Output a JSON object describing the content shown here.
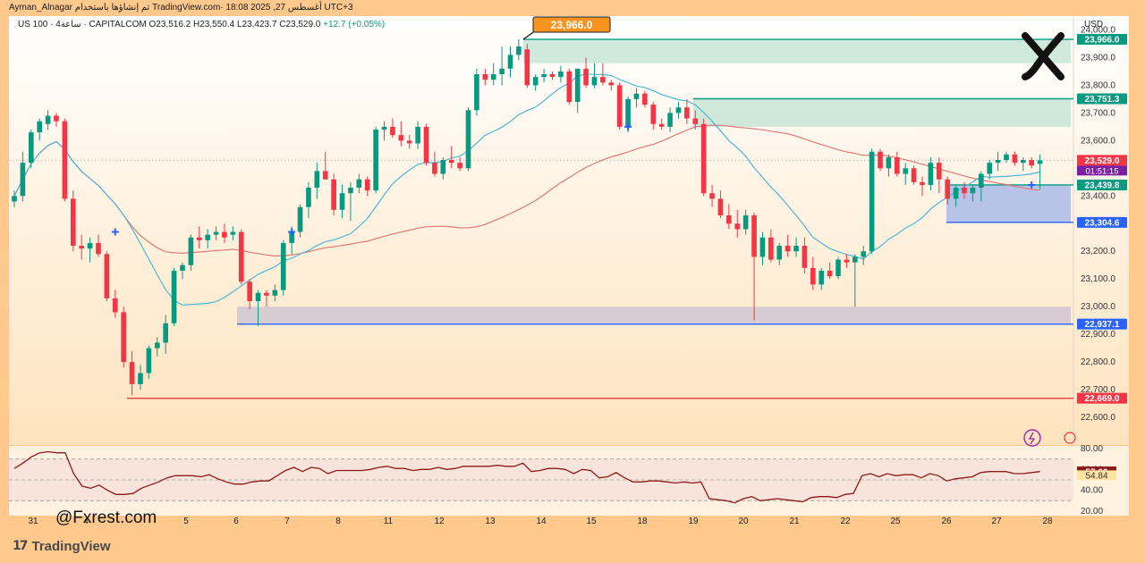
{
  "header": {
    "author": "Ayman_Alnagar",
    "published_text": "تم إنشاؤها باستخدام TradingView.com· 18:08 2025 ,27 أغسطس UTC+3"
  },
  "symbol": {
    "name": "US 100 · 4ساعة · CAPITALCOM",
    "open": "O23,516.2",
    "high": "H23,550.4",
    "low": "L23,423.7",
    "close": "C23,529.0",
    "change": "+12.7 (+0.05%)"
  },
  "currency": "USD",
  "watermark": "@Fxrest.com",
  "brand": {
    "logo": "17",
    "name": "TradingView"
  },
  "colors": {
    "up": "#089981",
    "down": "#F23645",
    "ma_fast": "#4DB8D4",
    "ma_slow": "#E07A78",
    "rsi": "#8B1A1A",
    "supply_zone": "#BFE3D2",
    "demand_zone": "#9FB3E8",
    "support_zone": "#C9C2D2",
    "page_bg": "#FFC98E"
  },
  "chart_data": {
    "type": "candlestick",
    "y_axis": {
      "min": 22500,
      "max": 24050,
      "ticks": [
        22600,
        22700,
        22800,
        22900,
        23000,
        23100,
        23200,
        23300,
        23400,
        23500,
        23600,
        23700,
        23800,
        23900,
        24000
      ],
      "tick_labels": [
        "22,600.0",
        "22,700.0",
        "22,800.0",
        "22,900.0",
        "23,000.0",
        "23,100.0",
        "23,200.0",
        "23,300.0",
        "23,400.0",
        "23,500.0",
        "23,600.0",
        "23,700.0",
        "23,800.0",
        "23,900.0",
        "24,000.0"
      ]
    },
    "x_labels": [
      "31",
      "4",
      "5",
      "6",
      "7",
      "8",
      "11",
      "12",
      "13",
      "14",
      "15",
      "18",
      "19",
      "20",
      "21",
      "22",
      "25",
      "26",
      "27",
      "28"
    ],
    "candles": [
      [
        23380,
        23420,
        23360,
        23400
      ],
      [
        23400,
        23560,
        23380,
        23520
      ],
      [
        23520,
        23640,
        23500,
        23630
      ],
      [
        23630,
        23680,
        23600,
        23670
      ],
      [
        23660,
        23710,
        23640,
        23690
      ],
      [
        23690,
        23700,
        23650,
        23670
      ],
      [
        23670,
        23680,
        23380,
        23390
      ],
      [
        23390,
        23420,
        23200,
        23220
      ],
      [
        23220,
        23260,
        23170,
        23210
      ],
      [
        23210,
        23250,
        23160,
        23230
      ],
      [
        23230,
        23260,
        23180,
        23190
      ],
      [
        23190,
        23200,
        23020,
        23030
      ],
      [
        23030,
        23060,
        22960,
        22980
      ],
      [
        22980,
        23000,
        22780,
        22800
      ],
      [
        22800,
        22840,
        22680,
        22720
      ],
      [
        22720,
        22790,
        22700,
        22760
      ],
      [
        22760,
        22860,
        22740,
        22850
      ],
      [
        22850,
        22890,
        22820,
        22870
      ],
      [
        22870,
        22970,
        22830,
        22940
      ],
      [
        22940,
        23140,
        22930,
        23130
      ],
      [
        23130,
        23160,
        23100,
        23150
      ],
      [
        23150,
        23260,
        23130,
        23250
      ],
      [
        23250,
        23290,
        23210,
        23240
      ],
      [
        23240,
        23280,
        23210,
        23260
      ],
      [
        23260,
        23290,
        23240,
        23270
      ],
      [
        23270,
        23300,
        23230,
        23250
      ],
      [
        23260,
        23290,
        23240,
        23270
      ],
      [
        23270,
        23280,
        23080,
        23090
      ],
      [
        23090,
        23100,
        22990,
        23020
      ],
      [
        23020,
        23060,
        22930,
        23050
      ],
      [
        23050,
        23060,
        23000,
        23040
      ],
      [
        23040,
        23080,
        23020,
        23060
      ],
      [
        23060,
        23240,
        23040,
        23230
      ],
      [
        23230,
        23290,
        23190,
        23270
      ],
      [
        23270,
        23370,
        23250,
        23360
      ],
      [
        23360,
        23450,
        23320,
        23430
      ],
      [
        23430,
        23520,
        23390,
        23490
      ],
      [
        23490,
        23560,
        23460,
        23460
      ],
      [
        23460,
        23480,
        23330,
        23350
      ],
      [
        23350,
        23440,
        23320,
        23410
      ],
      [
        23410,
        23450,
        23310,
        23430
      ],
      [
        23430,
        23480,
        23410,
        23460
      ],
      [
        23460,
        23470,
        23400,
        23420
      ],
      [
        23420,
        23650,
        23410,
        23640
      ],
      [
        23640,
        23670,
        23600,
        23650
      ],
      [
        23650,
        23680,
        23610,
        23620
      ],
      [
        23620,
        23670,
        23580,
        23600
      ],
      [
        23600,
        23620,
        23570,
        23590
      ],
      [
        23590,
        23670,
        23570,
        23650
      ],
      [
        23650,
        23660,
        23510,
        23520
      ],
      [
        23520,
        23560,
        23470,
        23480
      ],
      [
        23480,
        23540,
        23460,
        23530
      ],
      [
        23530,
        23580,
        23500,
        23520
      ],
      [
        23520,
        23540,
        23490,
        23500
      ],
      [
        23500,
        23720,
        23490,
        23710
      ],
      [
        23710,
        23860,
        23690,
        23840
      ],
      [
        23840,
        23860,
        23800,
        23820
      ],
      [
        23820,
        23880,
        23800,
        23840
      ],
      [
        23840,
        23940,
        23800,
        23860
      ],
      [
        23860,
        23940,
        23830,
        23910
      ],
      [
        23910,
        23966,
        23890,
        23940
      ],
      [
        23930,
        23950,
        23790,
        23800
      ],
      [
        23800,
        23840,
        23780,
        23830
      ],
      [
        23830,
        23860,
        23810,
        23840
      ],
      [
        23840,
        23850,
        23820,
        23830
      ],
      [
        23830,
        23870,
        23810,
        23850
      ],
      [
        23850,
        23860,
        23730,
        23740
      ],
      [
        23740,
        23860,
        23700,
        23860
      ],
      [
        23860,
        23900,
        23790,
        23800
      ],
      [
        23800,
        23880,
        23790,
        23830
      ],
      [
        23830,
        23880,
        23800,
        23810
      ],
      [
        23810,
        23820,
        23780,
        23800
      ],
      [
        23800,
        23810,
        23640,
        23650
      ],
      [
        23650,
        23760,
        23630,
        23750
      ],
      [
        23750,
        23790,
        23720,
        23770
      ],
      [
        23770,
        23780,
        23720,
        23730
      ],
      [
        23730,
        23740,
        23640,
        23660
      ],
      [
        23660,
        23680,
        23640,
        23650
      ],
      [
        23650,
        23720,
        23630,
        23700
      ],
      [
        23700,
        23740,
        23680,
        23720
      ],
      [
        23720,
        23750,
        23660,
        23680
      ],
      [
        23680,
        23710,
        23640,
        23660
      ],
      [
        23660,
        23680,
        23400,
        23410
      ],
      [
        23410,
        23440,
        23360,
        23390
      ],
      [
        23390,
        23420,
        23320,
        23330
      ],
      [
        23330,
        23370,
        23280,
        23300
      ],
      [
        23300,
        23350,
        23250,
        23280
      ],
      [
        23280,
        23350,
        23260,
        23330
      ],
      [
        23330,
        23340,
        22950,
        23180
      ],
      [
        23180,
        23270,
        23150,
        23250
      ],
      [
        23250,
        23280,
        23160,
        23170
      ],
      [
        23170,
        23230,
        23150,
        23220
      ],
      [
        23220,
        23260,
        23180,
        23200
      ],
      [
        23200,
        23250,
        23180,
        23220
      ],
      [
        23220,
        23250,
        23120,
        23140
      ],
      [
        23140,
        23180,
        23060,
        23080
      ],
      [
        23080,
        23140,
        23060,
        23130
      ],
      [
        23130,
        23160,
        23100,
        23110
      ],
      [
        23110,
        23180,
        23100,
        23170
      ],
      [
        23170,
        23190,
        23140,
        23160
      ],
      [
        23160,
        23190,
        23000,
        23180
      ],
      [
        23180,
        23220,
        23150,
        23200
      ],
      [
        23200,
        23570,
        23190,
        23560
      ],
      [
        23560,
        23570,
        23490,
        23500
      ],
      [
        23500,
        23550,
        23470,
        23540
      ],
      [
        23540,
        23560,
        23470,
        23480
      ],
      [
        23480,
        23520,
        23440,
        23500
      ],
      [
        23500,
        23510,
        23440,
        23450
      ],
      [
        23450,
        23470,
        23400,
        23440
      ],
      [
        23440,
        23540,
        23420,
        23520
      ],
      [
        23520,
        23540,
        23410,
        23460
      ],
      [
        23460,
        23470,
        23370,
        23390
      ],
      [
        23390,
        23440,
        23360,
        23430
      ],
      [
        23430,
        23450,
        23390,
        23410
      ],
      [
        23410,
        23440,
        23380,
        23430
      ],
      [
        23430,
        23490,
        23380,
        23480
      ],
      [
        23480,
        23530,
        23460,
        23520
      ],
      [
        23520,
        23560,
        23490,
        23530
      ],
      [
        23530,
        23560,
        23520,
        23550
      ],
      [
        23550,
        23560,
        23510,
        23520
      ],
      [
        23520,
        23540,
        23490,
        23530
      ],
      [
        23530,
        23540,
        23500,
        23510
      ],
      [
        23516,
        23550,
        23424,
        23529
      ]
    ],
    "levels": [
      {
        "price": 23966.0,
        "label": "23,966.0",
        "color": "#089981"
      },
      {
        "price": 23751.3,
        "label": "23,751.3",
        "color": "#089981"
      },
      {
        "price": 23529.0,
        "label": "23,529.0",
        "color": "#F23645"
      },
      {
        "price": 23439.8,
        "label": "23,439.8",
        "color": "#089981"
      },
      {
        "price": 23304.6,
        "label": "23,304.6",
        "color": "#2962FF"
      },
      {
        "price": 22937.1,
        "label": "22,937.1",
        "color": "#2962FF"
      },
      {
        "price": 22669.0,
        "label": "22,669.0",
        "color": "#F23645"
      }
    ],
    "countdown": "01:51:15",
    "callout": "23,966.0",
    "zones": [
      {
        "top": 23966,
        "bottom": 23880,
        "kind": "supply"
      },
      {
        "top": 23751,
        "bottom": 23650,
        "kind": "supply"
      },
      {
        "top": 23440,
        "bottom": 23304,
        "kind": "demand"
      },
      {
        "top": 23000,
        "bottom": 22937,
        "kind": "support"
      }
    ],
    "rsi": {
      "ticks": [
        20.0,
        40.0,
        60.0,
        80.0
      ],
      "tick_labels": [
        "20.00",
        "40.00",
        "60.00",
        "80.00"
      ],
      "value": "57.69",
      "ma_value": "54.84",
      "series": [
        61,
        66,
        72,
        76,
        77,
        76,
        76,
        56,
        44,
        42,
        45,
        40,
        36,
        36,
        37,
        42,
        45,
        48,
        52,
        54,
        54,
        54,
        53,
        55,
        51,
        48,
        46,
        46,
        48,
        49,
        49,
        54,
        59,
        62,
        58,
        62,
        61,
        56,
        59,
        59,
        59,
        59,
        60,
        62,
        63,
        61,
        61,
        59,
        60,
        60,
        62,
        60,
        61,
        63,
        63,
        63,
        63,
        64,
        63,
        63,
        66,
        58,
        59,
        61,
        61,
        60,
        56,
        60,
        59,
        52,
        53,
        57,
        52,
        48,
        48,
        49,
        49,
        48,
        47,
        48,
        47,
        48,
        32,
        31,
        30,
        28,
        32,
        34,
        30,
        31,
        32,
        31,
        30,
        29,
        33,
        34,
        34,
        33,
        36,
        37,
        54,
        56,
        53,
        56,
        54,
        55,
        55,
        52,
        56,
        54,
        49,
        51,
        52,
        53,
        57,
        58,
        58,
        58,
        56,
        56,
        57,
        58
      ]
    }
  }
}
